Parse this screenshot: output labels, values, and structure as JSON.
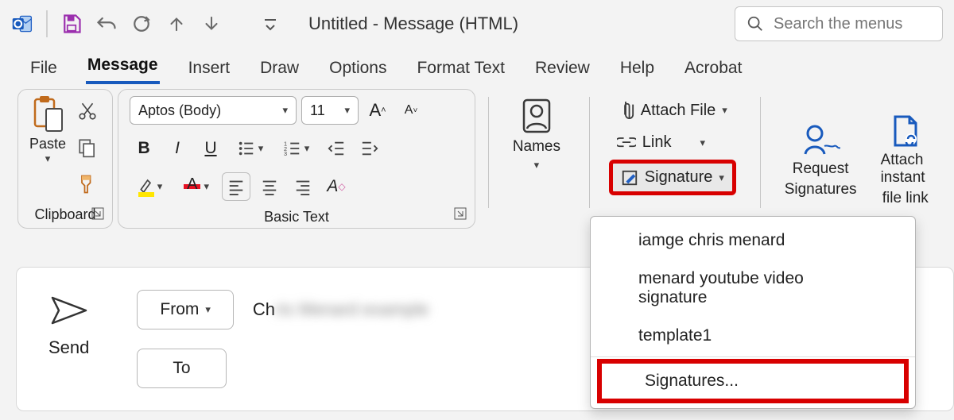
{
  "titlebar": {
    "caption": "Untitled  -  Message (HTML)",
    "search_placeholder": "Search the menus"
  },
  "tabs": [
    "File",
    "Message",
    "Insert",
    "Draw",
    "Options",
    "Format Text",
    "Review",
    "Help",
    "Acrobat"
  ],
  "active_tab": "Message",
  "clipboard": {
    "paste": "Paste",
    "title": "Clipboard"
  },
  "font": {
    "name": "Aptos (Body)",
    "size": "11",
    "title": "Basic Text"
  },
  "names": {
    "label": "Names"
  },
  "include": {
    "attach": "Attach File",
    "link": "Link",
    "signature": "Signature"
  },
  "adobe": {
    "request1": "Request",
    "request2": "Signatures",
    "instant1": "Attach instant",
    "instant2": "file link"
  },
  "signature_menu": {
    "items": [
      "iamge chris menard",
      "menard youtube video signature",
      "template1"
    ],
    "more": "Signatures..."
  },
  "compose": {
    "send": "Send",
    "from": "From",
    "to": "To",
    "from_value": "Ch"
  }
}
